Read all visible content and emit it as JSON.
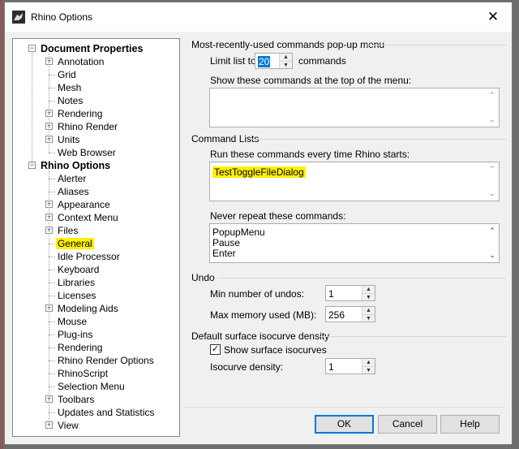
{
  "window": {
    "title": "Rhino Options"
  },
  "tree": {
    "items": [
      {
        "label": "Document Properties",
        "level": 0,
        "expander": "minus",
        "root": true
      },
      {
        "label": "Annotation",
        "level": 1,
        "expander": "plus"
      },
      {
        "label": "Grid",
        "level": 1
      },
      {
        "label": "Mesh",
        "level": 1
      },
      {
        "label": "Notes",
        "level": 1
      },
      {
        "label": "Rendering",
        "level": 1,
        "expander": "plus"
      },
      {
        "label": "Rhino Render",
        "level": 1,
        "expander": "plus"
      },
      {
        "label": "Units",
        "level": 1,
        "expander": "plus"
      },
      {
        "label": "Web Browser",
        "level": 1
      },
      {
        "label": "Rhino Options",
        "level": 0,
        "expander": "minus",
        "root": true
      },
      {
        "label": "Alerter",
        "level": 1
      },
      {
        "label": "Aliases",
        "level": 1
      },
      {
        "label": "Appearance",
        "level": 1,
        "expander": "plus"
      },
      {
        "label": "Context Menu",
        "level": 1,
        "expander": "plus"
      },
      {
        "label": "Files",
        "level": 1,
        "expander": "plus"
      },
      {
        "label": "General",
        "level": 1,
        "selected": true
      },
      {
        "label": "Idle Processor",
        "level": 1
      },
      {
        "label": "Keyboard",
        "level": 1
      },
      {
        "label": "Libraries",
        "level": 1
      },
      {
        "label": "Licenses",
        "level": 1
      },
      {
        "label": "Modeling Aids",
        "level": 1,
        "expander": "plus"
      },
      {
        "label": "Mouse",
        "level": 1
      },
      {
        "label": "Plug-ins",
        "level": 1
      },
      {
        "label": "Rendering",
        "level": 1
      },
      {
        "label": "Rhino Render Options",
        "level": 1
      },
      {
        "label": "RhinoScript",
        "level": 1
      },
      {
        "label": "Selection Menu",
        "level": 1
      },
      {
        "label": "Toolbars",
        "level": 1,
        "expander": "plus"
      },
      {
        "label": "Updates and Statistics",
        "level": 1
      },
      {
        "label": "View",
        "level": 1,
        "expander": "plus"
      }
    ]
  },
  "mru": {
    "section": "Most-recently-used commands pop-up menu",
    "limit_label": "Limit list to",
    "limit_value": "20",
    "limit_suffix": "commands",
    "show_label": "Show these commands at the top of the menu:"
  },
  "command_lists": {
    "section": "Command Lists",
    "startup_label": "Run these commands every time Rhino starts:",
    "startup_lines": [
      "TestToggleFileDialog"
    ],
    "never_label": "Never repeat these commands:",
    "never_lines": [
      "PopupMenu",
      "Pause",
      "Enter"
    ]
  },
  "undo": {
    "section": "Undo",
    "min_label": "Min number of undos:",
    "min_value": "1",
    "mem_label": "Max memory used (MB):",
    "mem_value": "256"
  },
  "isocurve": {
    "section": "Default surface isocurve density",
    "show_label": "Show surface isocurves",
    "show_checked": true,
    "density_label": "Isocurve density:",
    "density_value": "1"
  },
  "buttons": {
    "ok": "OK",
    "cancel": "Cancel",
    "help": "Help"
  },
  "colors": {
    "highlight": "#fff000",
    "accent": "#0078d7"
  }
}
